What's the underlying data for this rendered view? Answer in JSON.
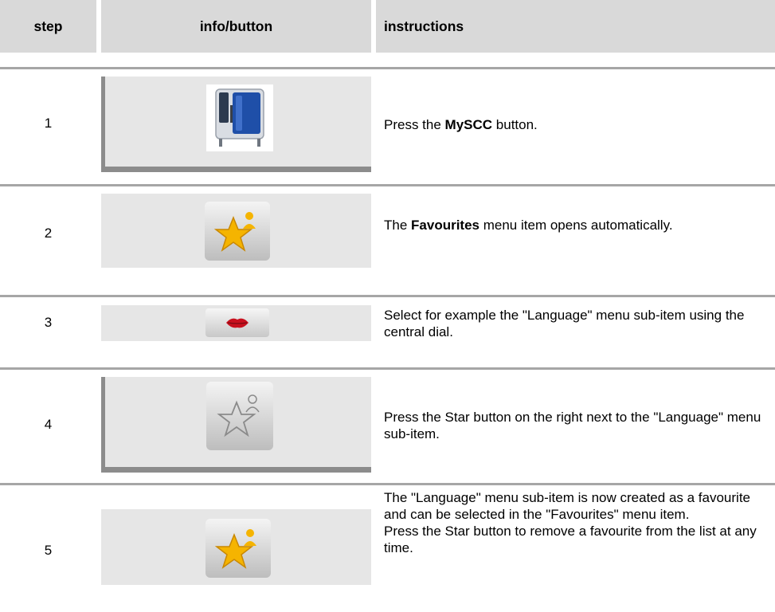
{
  "header": {
    "step": "step",
    "info": "info/button",
    "instructions": "instructions"
  },
  "rows": [
    {
      "step": "1",
      "icon": "myscc-oven-icon",
      "instr_pre": "Press the ",
      "instr_bold": "MySCC",
      "instr_post": " button."
    },
    {
      "step": "2",
      "icon": "favourites-star-icon",
      "instr_pre": "The ",
      "instr_bold": "Favourites",
      "instr_post": " menu item opens automatically."
    },
    {
      "step": "3",
      "icon": "language-lips-icon",
      "instr_text": "Select for example the \"Language\" menu sub-item using the central dial."
    },
    {
      "step": "4",
      "icon": "star-outline-icon",
      "instr_text": "Press the Star button on the right next to the \"Language\" menu sub-item."
    },
    {
      "step": "5",
      "icon": "favourites-star-icon",
      "instr_line1": "The \"Language\" menu sub-item is now created as a favourite and can be selected in the \"Favourites\" menu item.",
      "instr_line2": "Press the Star button to remove a favourite from the list at any time."
    }
  ],
  "colors": {
    "header_bg": "#d9d9d9",
    "panel_bg": "#e6e6e6",
    "frame": "#8c8c8c",
    "rule": "#a6a6a6",
    "star": "#f5b400",
    "lips": "#c8101e",
    "oven_blue": "#1f4fa8"
  }
}
